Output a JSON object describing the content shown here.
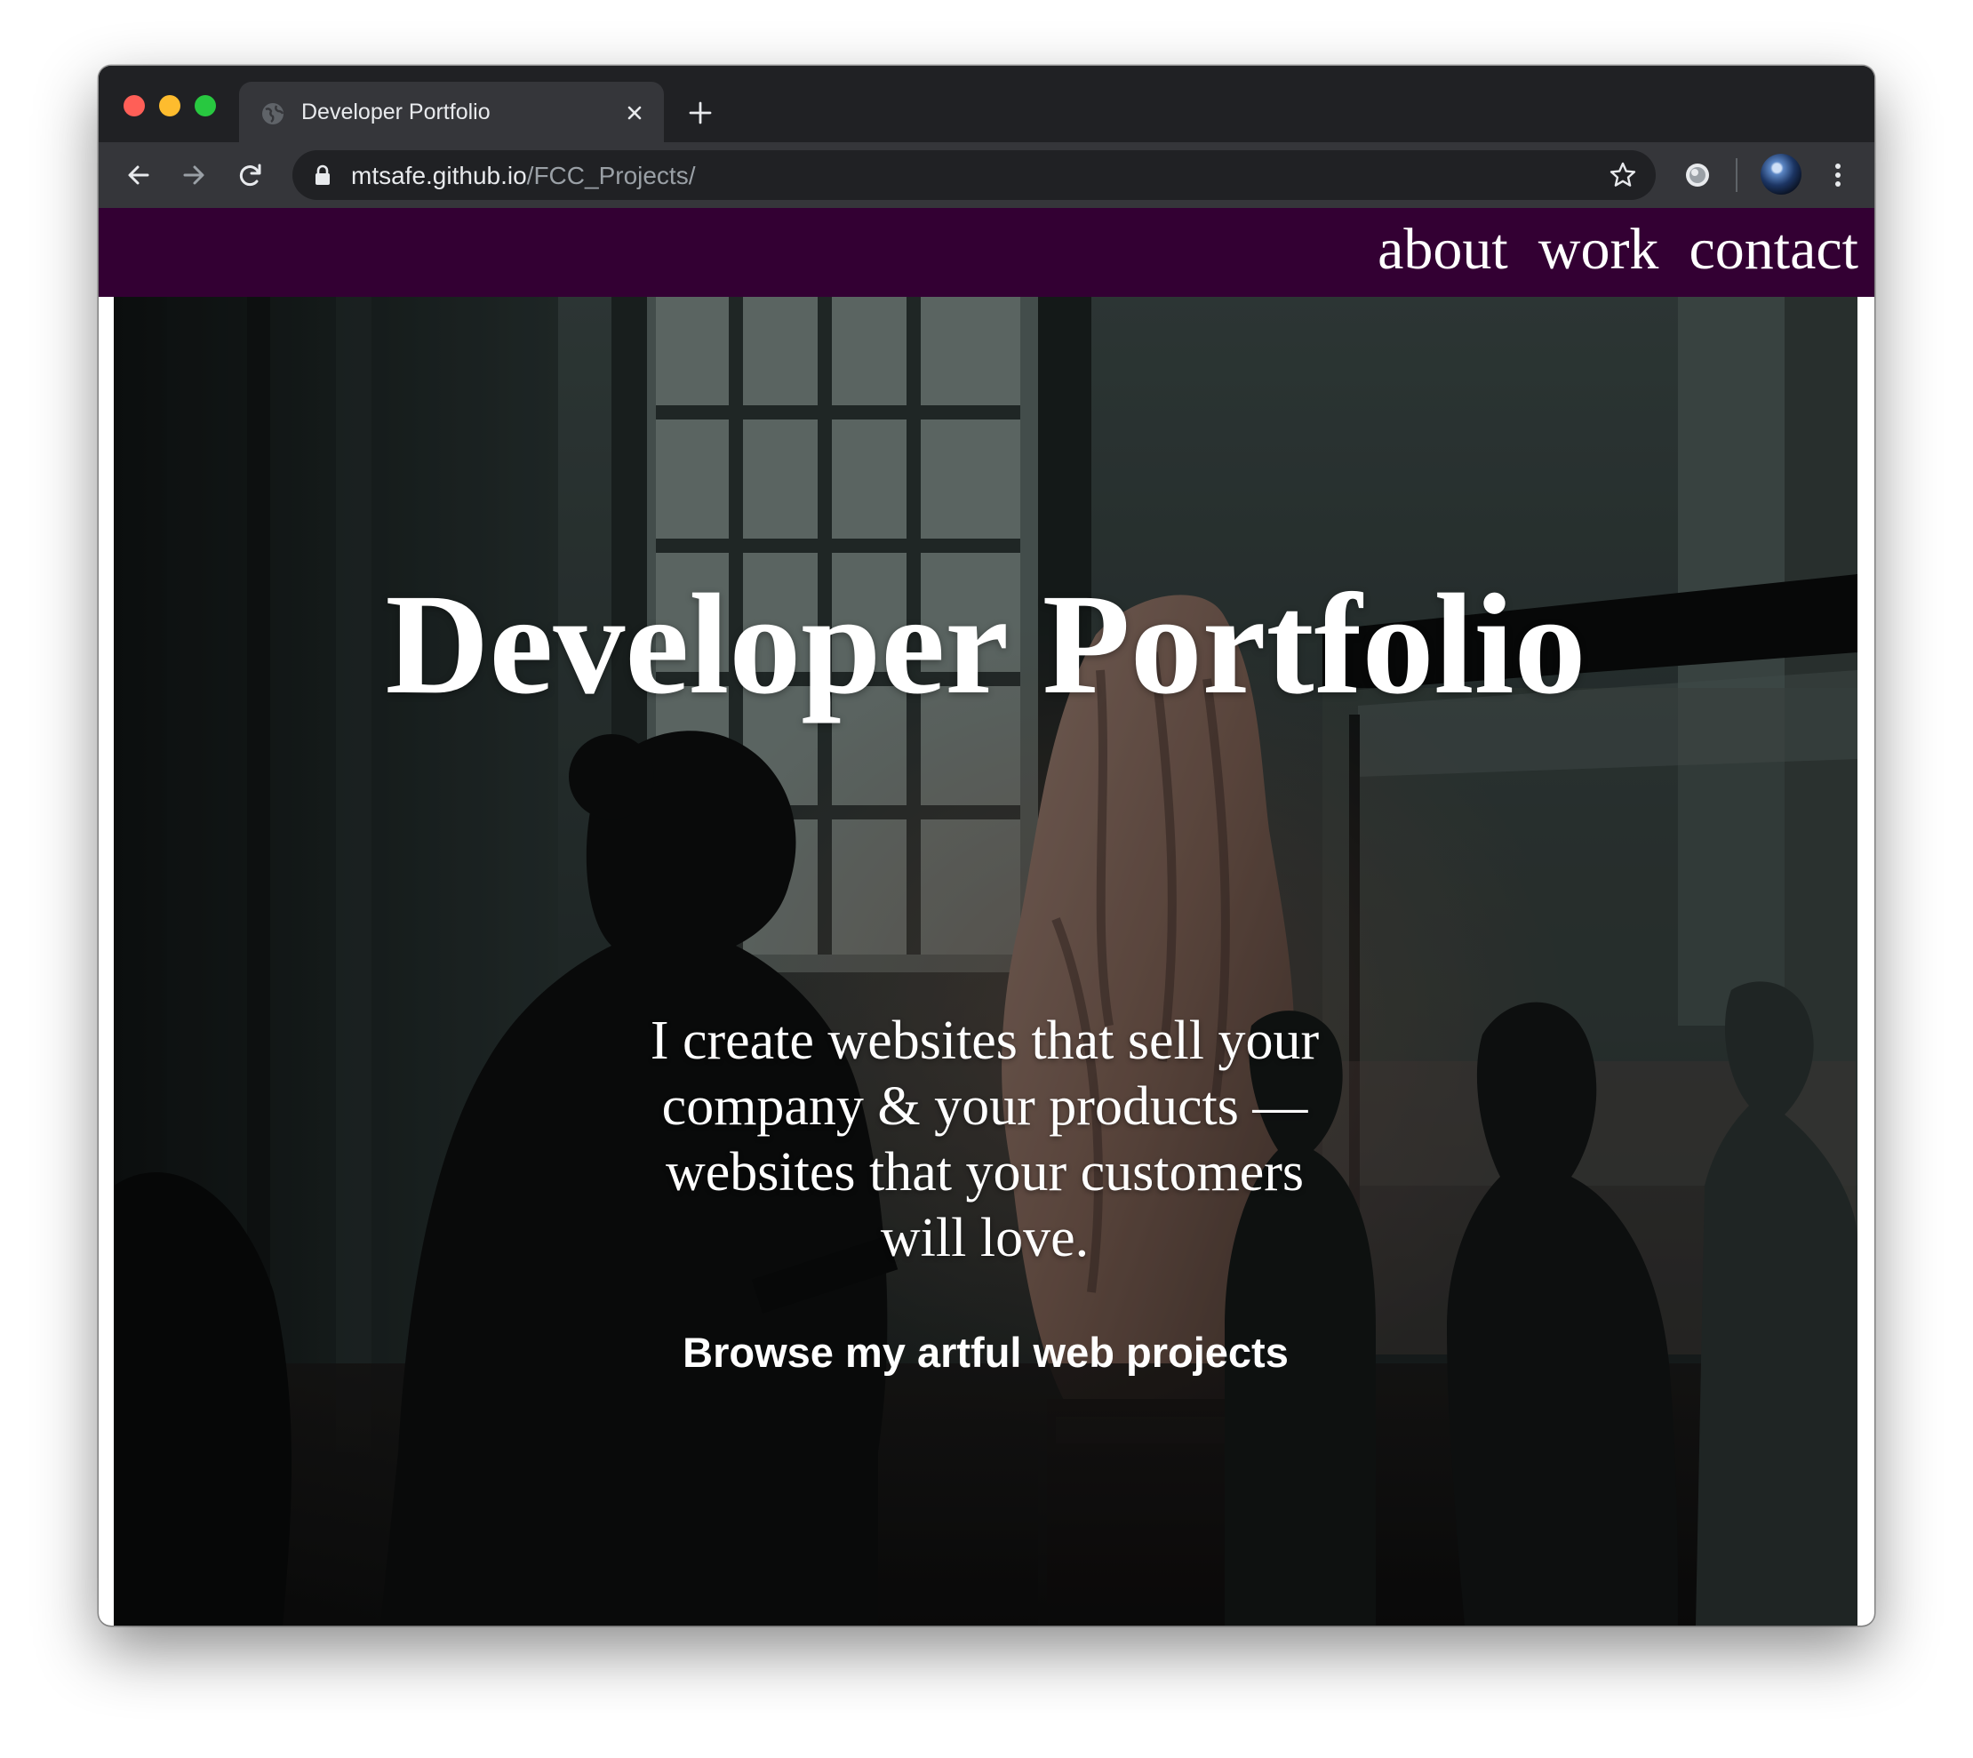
{
  "browser": {
    "tab_title": "Developer Portfolio",
    "url_host": "mtsafe.github.io",
    "url_path": "/FCC_Projects/"
  },
  "site": {
    "nav": [
      "about",
      "work",
      "contact"
    ],
    "hero_title": "Developer Portfolio",
    "tagline": "I create websites that sell your company & your products — websites that your customers will love.",
    "cta": "Browse my artful web projects"
  },
  "colors": {
    "nav_background": "#330033",
    "browser_frame": "#202124",
    "toolbar": "#35363a"
  },
  "icons": [
    "globe-icon",
    "close-icon",
    "plus-icon",
    "back-arrow-icon",
    "forward-arrow-icon",
    "reload-icon",
    "lock-icon",
    "star-icon",
    "extension-icon",
    "kebab-menu-icon"
  ]
}
